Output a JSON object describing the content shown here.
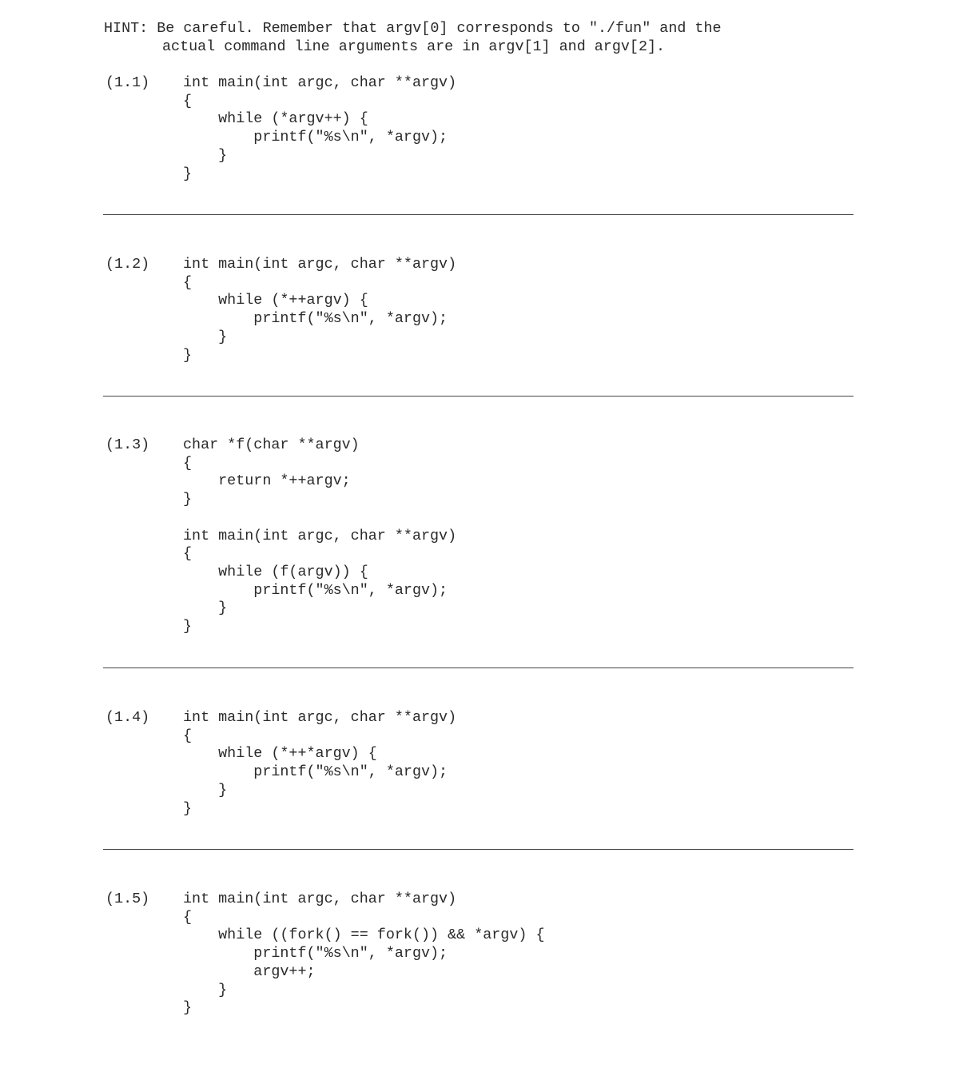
{
  "hint": {
    "line1": "HINT: Be careful. Remember that argv[0] corresponds to \"./fun\" and the",
    "line2": "actual command line arguments are in argv[1] and argv[2]."
  },
  "problems": [
    {
      "label": "(1.1)",
      "code": "int main(int argc, char **argv)\n{\n    while (*argv++) {\n        printf(\"%s\\n\", *argv);\n    }\n}"
    },
    {
      "label": "(1.2)",
      "code": "int main(int argc, char **argv)\n{\n    while (*++argv) {\n        printf(\"%s\\n\", *argv);\n    }\n}"
    },
    {
      "label": "(1.3)",
      "code": "char *f(char **argv)\n{\n    return *++argv;\n}\n\nint main(int argc, char **argv)\n{\n    while (f(argv)) {\n        printf(\"%s\\n\", *argv);\n    }\n}"
    },
    {
      "label": "(1.4)",
      "code": "int main(int argc, char **argv)\n{\n    while (*++*argv) {\n        printf(\"%s\\n\", *argv);\n    }\n}"
    },
    {
      "label": "(1.5)",
      "code": "int main(int argc, char **argv)\n{\n    while ((fork() == fork()) && *argv) {\n        printf(\"%s\\n\", *argv);\n        argv++;\n    }\n}"
    }
  ]
}
